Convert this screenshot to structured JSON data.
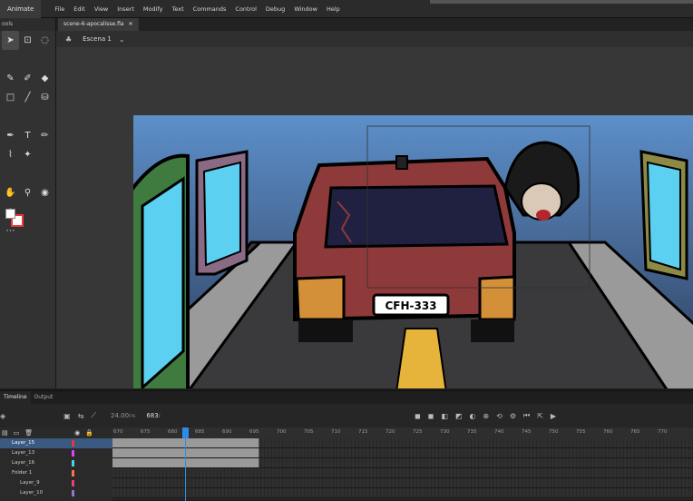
{
  "app": {
    "name": "Animate"
  },
  "menu": [
    "File",
    "Edit",
    "View",
    "Insert",
    "Modify",
    "Text",
    "Commands",
    "Control",
    "Debug",
    "Window",
    "Help"
  ],
  "tools_panel": {
    "title": "ools"
  },
  "document": {
    "tab": "scene-6-apocalisse.fla",
    "scene": "Escena 1"
  },
  "stage": {
    "license_plate": "CFH-333"
  },
  "timeline": {
    "tabs": [
      "Timeline",
      "Output"
    ],
    "fps": "24.00",
    "fps_unit": "FPS",
    "current_frame": "683",
    "ruler": [
      "670",
      "675",
      "680",
      "685",
      "690",
      "695",
      "700",
      "705",
      "710",
      "715",
      "720",
      "725",
      "730",
      "735",
      "740",
      "745",
      "750",
      "755",
      "760",
      "765",
      "770"
    ],
    "layers": [
      "Layer_15",
      "Layer_13",
      "Layer_16",
      "Folder 1",
      "Layer_9",
      "Layer_10"
    ]
  },
  "colors": {
    "accent": "#2d8ceb",
    "selected_layer": "#3a5a82",
    "stroke_swatch": "#e53935"
  }
}
